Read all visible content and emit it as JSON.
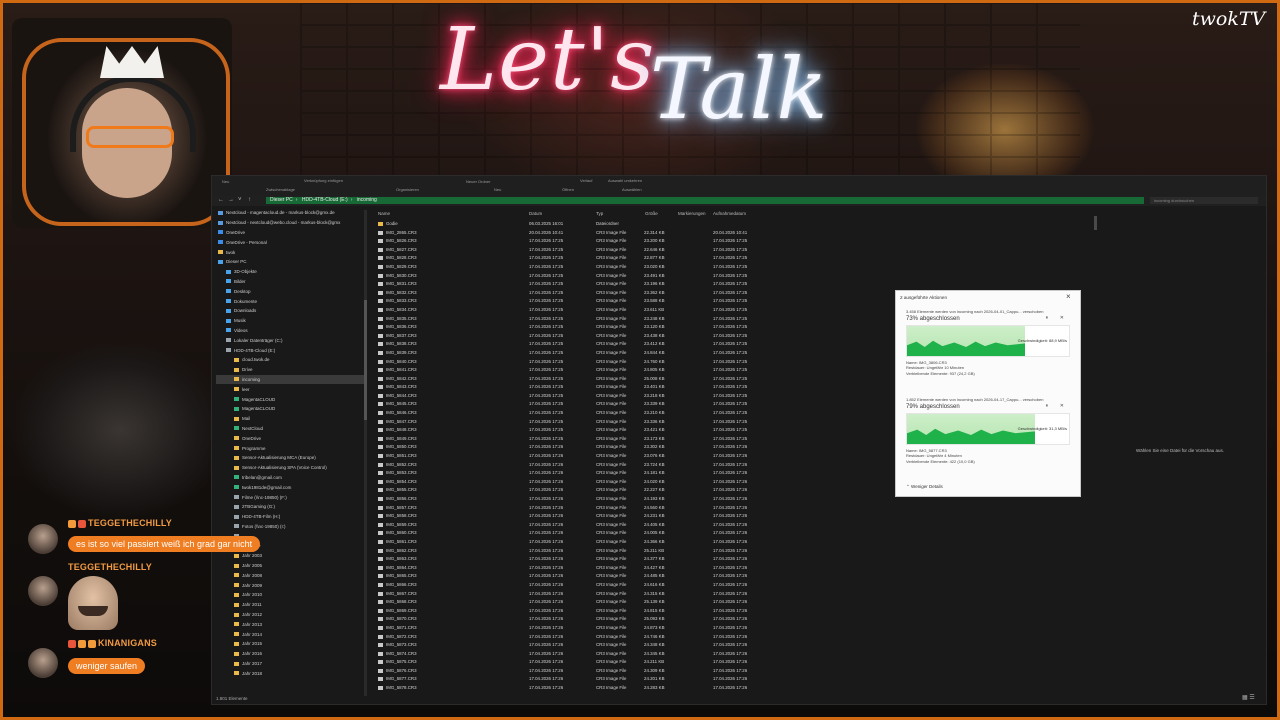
{
  "overlay": {
    "neon_lets": "Let's",
    "neon_talk": "Talk",
    "logo": "twokTV"
  },
  "ribbon": [
    "Neu",
    "Zwischenablage",
    "Verknüpfung einfügen",
    "Organisieren",
    "Neuer Ordner",
    "Neu",
    "Öffnen",
    "Alles auswählen",
    "Auswahl umkehren",
    "Auswählen",
    "Verlauf"
  ],
  "address": {
    "path": [
      "Dieser PC",
      "HDD-4TB-Cloud (E:)",
      "incoming"
    ],
    "search_placeholder": "incoming durchsuchen"
  },
  "nav": [
    {
      "label": "Nextcloud - magentacloud.de - markus-block@gmx.de",
      "color": "#5a9be0"
    },
    {
      "label": "Nextcloud - nextcloud@webo.cloud - markus-block@gmx",
      "color": "#5a9be0"
    },
    {
      "label": "OneDrive",
      "color": "#3c8ce8"
    },
    {
      "label": "OneDrive - Personal",
      "color": "#3c8ce8"
    },
    {
      "label": "twok",
      "color": "#e9b949"
    },
    {
      "label": "Dieser PC",
      "color": "#4aa3e8"
    },
    {
      "label": "3D-Objekte",
      "color": "#4aa3e8"
    },
    {
      "label": "Bilder",
      "color": "#4aa3e8"
    },
    {
      "label": "Desktop",
      "color": "#4aa3e8"
    },
    {
      "label": "Dokumente",
      "color": "#4aa3e8"
    },
    {
      "label": "Downloads",
      "color": "#4aa3e8"
    },
    {
      "label": "Musik",
      "color": "#4aa3e8"
    },
    {
      "label": "Videos",
      "color": "#4aa3e8"
    },
    {
      "label": "Lokaler Datenträger (C:)",
      "color": "#9aa4ad"
    },
    {
      "label": "HDD-4TB-Cloud (E:)",
      "color": "#9aa4ad"
    },
    {
      "label": "cloud.twok.de",
      "color": "#e9b949"
    },
    {
      "label": "Drive",
      "color": "#e9b949"
    },
    {
      "label": "incoming",
      "color": "#e9b949",
      "sel": true
    },
    {
      "label": "leer",
      "color": "#e9b949"
    },
    {
      "label": "MagentaCLOUD",
      "color": "#33b37a"
    },
    {
      "label": "MagentaCLOUD",
      "color": "#33b37a"
    },
    {
      "label": "Mail",
      "color": "#e9b949"
    },
    {
      "label": "NextCloud",
      "color": "#33b37a"
    },
    {
      "label": "OneDrive",
      "color": "#e9b949"
    },
    {
      "label": "Programme",
      "color": "#e9b949"
    },
    {
      "label": "Sensor-Aktualisierung MCA (Europe)",
      "color": "#e9b949"
    },
    {
      "label": "Sensor-Aktualisierung SPA (Voice Control)",
      "color": "#e9b949"
    },
    {
      "label": "tribelan@gmail.com",
      "color": "#33b37a"
    },
    {
      "label": "twok1981de@gmail.com",
      "color": "#33b37a"
    },
    {
      "label": "Filme (\\\\nc-19850) (F:)",
      "color": "#9aa4ad"
    },
    {
      "label": "2TBGaming (G:)",
      "color": "#9aa4ad"
    },
    {
      "label": "HDD-4TB-Film (H:)",
      "color": "#9aa4ad"
    },
    {
      "label": "Fotos (\\\\nc-19850) (I:)",
      "color": "#9aa4ad"
    },
    {
      "label": "",
      "color": "#9aa4ad"
    },
    {
      "label": "$Recycle",
      "color": "#e9b949"
    },
    {
      "label": "Jahr 2003",
      "color": "#e9b949"
    },
    {
      "label": "Jahr 2005",
      "color": "#e9b949"
    },
    {
      "label": "Jahr 2008",
      "color": "#e9b949"
    },
    {
      "label": "Jahr 2009",
      "color": "#e9b949"
    },
    {
      "label": "Jahr 2010",
      "color": "#e9b949"
    },
    {
      "label": "Jahr 2011",
      "color": "#e9b949"
    },
    {
      "label": "Jahr 2012",
      "color": "#e9b949"
    },
    {
      "label": "Jahr 2013",
      "color": "#e9b949"
    },
    {
      "label": "Jahr 2014",
      "color": "#e9b949"
    },
    {
      "label": "Jahr 2015",
      "color": "#e9b949"
    },
    {
      "label": "Jahr 2016",
      "color": "#e9b949"
    },
    {
      "label": "Jahr 2017",
      "color": "#e9b949"
    },
    {
      "label": "Jahr 2018",
      "color": "#e9b949"
    }
  ],
  "columns": [
    "Name",
    "Datum",
    "Typ",
    "Größe",
    "Markierungen",
    "Aufnahmedatum"
  ],
  "folder_row": {
    "name": "Godie",
    "date": "06.03.2025 16:01",
    "type": "Dateiordner"
  },
  "files": [
    {
      "name": "IMG_2865.CR3",
      "date": "20.04.2026 10:41",
      "size": "22.314 KB",
      "taken": "20.04.2026 10:41"
    },
    {
      "name": "IMG_5826.CR3",
      "date": "17.04.2026 17:25",
      "size": "23.200 KB",
      "taken": "17.04.2026 17:25"
    },
    {
      "name": "IMG_5827.CR3",
      "date": "17.04.2026 17:25",
      "size": "22.646 KB",
      "taken": "17.04.2026 17:25"
    },
    {
      "name": "IMG_5828.CR3",
      "date": "17.04.2026 17:25",
      "size": "22.877 KB",
      "taken": "17.04.2026 17:25"
    },
    {
      "name": "IMG_5829.CR3",
      "date": "17.04.2026 17:25",
      "size": "23.020 KB",
      "taken": "17.04.2026 17:25"
    },
    {
      "name": "IMG_5830.CR3",
      "date": "17.04.2026 17:25",
      "size": "23.491 KB",
      "taken": "17.04.2026 17:25"
    },
    {
      "name": "IMG_5831.CR3",
      "date": "17.04.2026 17:25",
      "size": "23.196 KB",
      "taken": "17.04.2026 17:25"
    },
    {
      "name": "IMG_5832.CR3",
      "date": "17.04.2026 17:25",
      "size": "23.362 KB",
      "taken": "17.04.2026 17:25"
    },
    {
      "name": "IMG_5833.CR3",
      "date": "17.04.2026 17:25",
      "size": "23.588 KB",
      "taken": "17.04.2026 17:25"
    },
    {
      "name": "IMG_5834.CR3",
      "date": "17.04.2026 17:25",
      "size": "23.611 KB",
      "taken": "17.04.2026 17:25"
    },
    {
      "name": "IMG_5835.CR3",
      "date": "17.04.2026 17:25",
      "size": "23.248 KB",
      "taken": "17.04.2026 17:25"
    },
    {
      "name": "IMG_5836.CR3",
      "date": "17.04.2026 17:25",
      "size": "23.120 KB",
      "taken": "17.04.2026 17:25"
    },
    {
      "name": "IMG_5837.CR3",
      "date": "17.04.2026 17:25",
      "size": "23.438 KB",
      "taken": "17.04.2026 17:25"
    },
    {
      "name": "IMG_5838.CR3",
      "date": "17.04.2026 17:25",
      "size": "23.412 KB",
      "taken": "17.04.2026 17:25"
    },
    {
      "name": "IMG_5839.CR3",
      "date": "17.04.2026 17:25",
      "size": "24.844 KB",
      "taken": "17.04.2026 17:25"
    },
    {
      "name": "IMG_5840.CR3",
      "date": "17.04.2026 17:25",
      "size": "24.760 KB",
      "taken": "17.04.2026 17:25"
    },
    {
      "name": "IMG_5841.CR3",
      "date": "17.04.2026 17:25",
      "size": "24.805 KB",
      "taken": "17.04.2026 17:25"
    },
    {
      "name": "IMG_5842.CR3",
      "date": "17.04.2026 17:25",
      "size": "25.008 KB",
      "taken": "17.04.2026 17:25"
    },
    {
      "name": "IMG_5843.CR3",
      "date": "17.04.2026 17:25",
      "size": "23.401 KB",
      "taken": "17.04.2026 17:25"
    },
    {
      "name": "IMG_5844.CR3",
      "date": "17.04.2026 17:25",
      "size": "23.218 KB",
      "taken": "17.04.2026 17:25"
    },
    {
      "name": "IMG_5845.CR3",
      "date": "17.04.2026 17:25",
      "size": "23.339 KB",
      "taken": "17.04.2026 17:25"
    },
    {
      "name": "IMG_5846.CR3",
      "date": "17.04.2026 17:25",
      "size": "23.210 KB",
      "taken": "17.04.2026 17:25"
    },
    {
      "name": "IMG_5847.CR3",
      "date": "17.04.2026 17:25",
      "size": "23.336 KB",
      "taken": "17.04.2026 17:25"
    },
    {
      "name": "IMG_5848.CR3",
      "date": "17.04.2026 17:25",
      "size": "23.421 KB",
      "taken": "17.04.2026 17:25"
    },
    {
      "name": "IMG_5849.CR3",
      "date": "17.04.2026 17:25",
      "size": "23.173 KB",
      "taken": "17.04.2026 17:25"
    },
    {
      "name": "IMG_5850.CR3",
      "date": "17.04.2026 17:26",
      "size": "23.302 KB",
      "taken": "17.04.2026 17:26"
    },
    {
      "name": "IMG_5851.CR3",
      "date": "17.04.2026 17:26",
      "size": "23.076 KB",
      "taken": "17.04.2026 17:26"
    },
    {
      "name": "IMG_5852.CR3",
      "date": "17.04.2026 17:26",
      "size": "23.724 KB",
      "taken": "17.04.2026 17:26"
    },
    {
      "name": "IMG_5853.CR3",
      "date": "17.04.2026 17:26",
      "size": "24.181 KB",
      "taken": "17.04.2026 17:26"
    },
    {
      "name": "IMG_5854.CR3",
      "date": "17.04.2026 17:26",
      "size": "24.020 KB",
      "taken": "17.04.2026 17:26"
    },
    {
      "name": "IMG_5855.CR3",
      "date": "17.04.2026 17:26",
      "size": "22.227 KB",
      "taken": "17.04.2026 17:26"
    },
    {
      "name": "IMG_5856.CR3",
      "date": "17.04.2026 17:26",
      "size": "24.193 KB",
      "taken": "17.04.2026 17:26"
    },
    {
      "name": "IMG_5857.CR3",
      "date": "17.04.2026 17:26",
      "size": "24.560 KB",
      "taken": "17.04.2026 17:26"
    },
    {
      "name": "IMG_5858.CR3",
      "date": "17.04.2026 17:26",
      "size": "24.231 KB",
      "taken": "17.04.2026 17:26"
    },
    {
      "name": "IMG_5859.CR3",
      "date": "17.04.2026 17:26",
      "size": "24.405 KB",
      "taken": "17.04.2026 17:26"
    },
    {
      "name": "IMG_5860.CR3",
      "date": "17.04.2026 17:26",
      "size": "24.005 KB",
      "taken": "17.04.2026 17:26"
    },
    {
      "name": "IMG_5861.CR3",
      "date": "17.04.2026 17:26",
      "size": "24.366 KB",
      "taken": "17.04.2026 17:26"
    },
    {
      "name": "IMG_5862.CR3",
      "date": "17.04.2026 17:26",
      "size": "25.211 KB",
      "taken": "17.04.2026 17:26"
    },
    {
      "name": "IMG_5863.CR3",
      "date": "17.04.2026 17:26",
      "size": "24.377 KB",
      "taken": "17.04.2026 17:26"
    },
    {
      "name": "IMG_5864.CR3",
      "date": "17.04.2026 17:26",
      "size": "24.427 KB",
      "taken": "17.04.2026 17:26"
    },
    {
      "name": "IMG_5865.CR3",
      "date": "17.04.2026 17:26",
      "size": "24.485 KB",
      "taken": "17.04.2026 17:26"
    },
    {
      "name": "IMG_5866.CR3",
      "date": "17.04.2026 17:26",
      "size": "24.616 KB",
      "taken": "17.04.2026 17:26"
    },
    {
      "name": "IMG_5867.CR3",
      "date": "17.04.2026 17:26",
      "size": "24.315 KB",
      "taken": "17.04.2026 17:26"
    },
    {
      "name": "IMG_5868.CR3",
      "date": "17.04.2026 17:26",
      "size": "25.139 KB",
      "taken": "17.04.2026 17:26"
    },
    {
      "name": "IMG_5869.CR3",
      "date": "17.04.2026 17:26",
      "size": "24.815 KB",
      "taken": "17.04.2026 17:26"
    },
    {
      "name": "IMG_5870.CR3",
      "date": "17.04.2026 17:26",
      "size": "25.093 KB",
      "taken": "17.04.2026 17:26"
    },
    {
      "name": "IMG_5871.CR3",
      "date": "17.04.2026 17:26",
      "size": "24.873 KB",
      "taken": "17.04.2026 17:26"
    },
    {
      "name": "IMG_5872.CR3",
      "date": "17.04.2026 17:26",
      "size": "24.746 KB",
      "taken": "17.04.2026 17:26"
    },
    {
      "name": "IMG_5873.CR3",
      "date": "17.04.2026 17:26",
      "size": "24.348 KB",
      "taken": "17.04.2026 17:26"
    },
    {
      "name": "IMG_5874.CR3",
      "date": "17.04.2026 17:26",
      "size": "24.345 KB",
      "taken": "17.04.2026 17:26"
    },
    {
      "name": "IMG_5875.CR3",
      "date": "17.04.2026 17:26",
      "size": "24.211 KB",
      "taken": "17.04.2026 17:26"
    },
    {
      "name": "IMG_5876.CR3",
      "date": "17.04.2026 17:26",
      "size": "24.309 KB",
      "taken": "17.04.2026 17:26"
    },
    {
      "name": "IMG_5877.CR3",
      "date": "17.04.2026 17:26",
      "size": "24.201 KB",
      "taken": "17.04.2026 17:26"
    },
    {
      "name": "IMG_5878.CR3",
      "date": "17.04.2026 17:26",
      "size": "24.283 KB",
      "taken": "17.04.2026 17:26"
    }
  ],
  "file_type": "CR3 Image File",
  "preview_text": "Wählen Sie eine Datei für die Vorschau aus.",
  "status_text": "1.801 Elemente",
  "copy_dialog": {
    "title": "2 ausgeführte Aktionen",
    "op1": {
      "line": "3.458 Elemente werden von incoming nach 2026-04-01_Cappu... verschoben",
      "percent_text": "73% abgeschlossen",
      "progress": 0.73,
      "speed": "Geschwindigkeit: 88,9 MB/s",
      "name": "Name: IMG_3806.CR3",
      "remaining_time": "Restdauer: Ungefähr 10 Minuten",
      "remaining_items": "Verbleibende Elemente: 937 (24,2 GB)"
    },
    "op2": {
      "line": "1.852 Elemente werden von incoming nach 2026-04-17_Cappu... verschoben",
      "percent_text": "79% abgeschlossen",
      "progress": 0.79,
      "speed": "Geschwindigkeit: 31,3 MB/s",
      "name": "Name: IMG_5877.CR3",
      "remaining_time": "Restdauer: Ungefähr 4 Minuten",
      "remaining_items": "Verbleibende Elemente: 422 (10,0 GB)"
    },
    "less_details": "Weniger Details"
  },
  "chat": [
    {
      "user": "TEGGETHECHILLY",
      "message": "es ist so viel passiert weiß ich grad gar nicht"
    },
    {
      "user": "TEGGETHECHILLY",
      "message": ""
    },
    {
      "user": "KINANIGANS",
      "message": "weniger saufen"
    }
  ],
  "colors": {
    "accent": "#ef7d22",
    "frame": "#d06a12",
    "path_green": "#176a36",
    "progress_green": "#1fb14a"
  }
}
